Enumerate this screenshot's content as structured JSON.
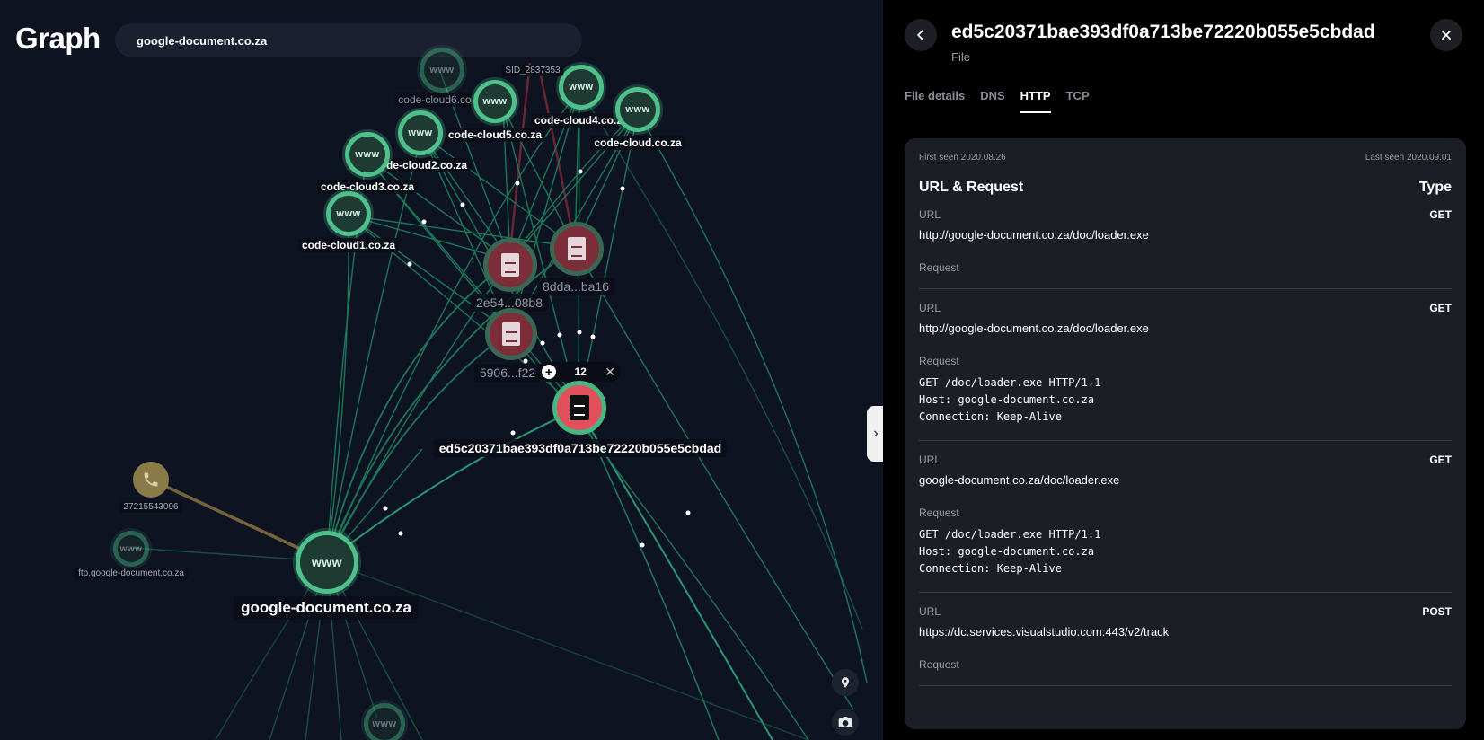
{
  "app": {
    "title": "Graph"
  },
  "search": {
    "value": "google-document.co.za"
  },
  "graph": {
    "node_labels": {
      "code_cloud6": "code-cloud6.co.za",
      "code_cloud5": "code-cloud5.co.za",
      "code_cloud4": "code-cloud4.co.za",
      "code_cloud": "code-cloud.co.za",
      "code_cloud2": "de-cloud2.co.za",
      "code_cloud3": "code-cloud3.co.za",
      "code_cloud1": "code-cloud1.co.za",
      "sid": "SID_2837353",
      "file_2e54": "2e54...08b8",
      "file_8dda": "8dda...ba16",
      "file_5906": "5906...f22",
      "selected_file": "ed5c20371bae393df0a713be72220b055e5cbdad",
      "phone": "27215543096",
      "ftp": "ftp.google-document.co.za",
      "main_domain": "google-document.co.za"
    },
    "domain_node_text": "www",
    "cluster_count": "12"
  },
  "panel": {
    "title": "ed5c20371bae393df0a713be72220b055e5cbdad",
    "subtitle": "File",
    "tabs": [
      "File details",
      "DNS",
      "HTTP",
      "TCP"
    ],
    "active_tab": "HTTP",
    "first_seen": "First seen 2020.08.26",
    "last_seen": "Last seen 2020.09.01",
    "section_title": "URL & Request",
    "type_label": "Type",
    "url_label": "URL",
    "request_label": "Request",
    "requests": [
      {
        "method": "GET",
        "url": "http://google-document.co.za/doc/loader.exe",
        "request": ""
      },
      {
        "method": "GET",
        "url": "http://google-document.co.za/doc/loader.exe",
        "request": "GET /doc/loader.exe HTTP/1.1\nHost: google-document.co.za\nConnection: Keep-Alive"
      },
      {
        "method": "GET",
        "url": "google-document.co.za/doc/loader.exe",
        "request": "GET /doc/loader.exe HTTP/1.1\nHost: google-document.co.za\nConnection: Keep-Alive"
      },
      {
        "method": "POST",
        "url": "https://dc.services.visualstudio.com:443/v2/track",
        "request": ""
      }
    ]
  },
  "colors": {
    "edge": "#1f8a63",
    "edge_red": "#7a2a38",
    "edge_phone": "#8a7340",
    "selected": "#e2505c",
    "panel_bg": "#000000",
    "card_bg": "#1c1e26"
  }
}
